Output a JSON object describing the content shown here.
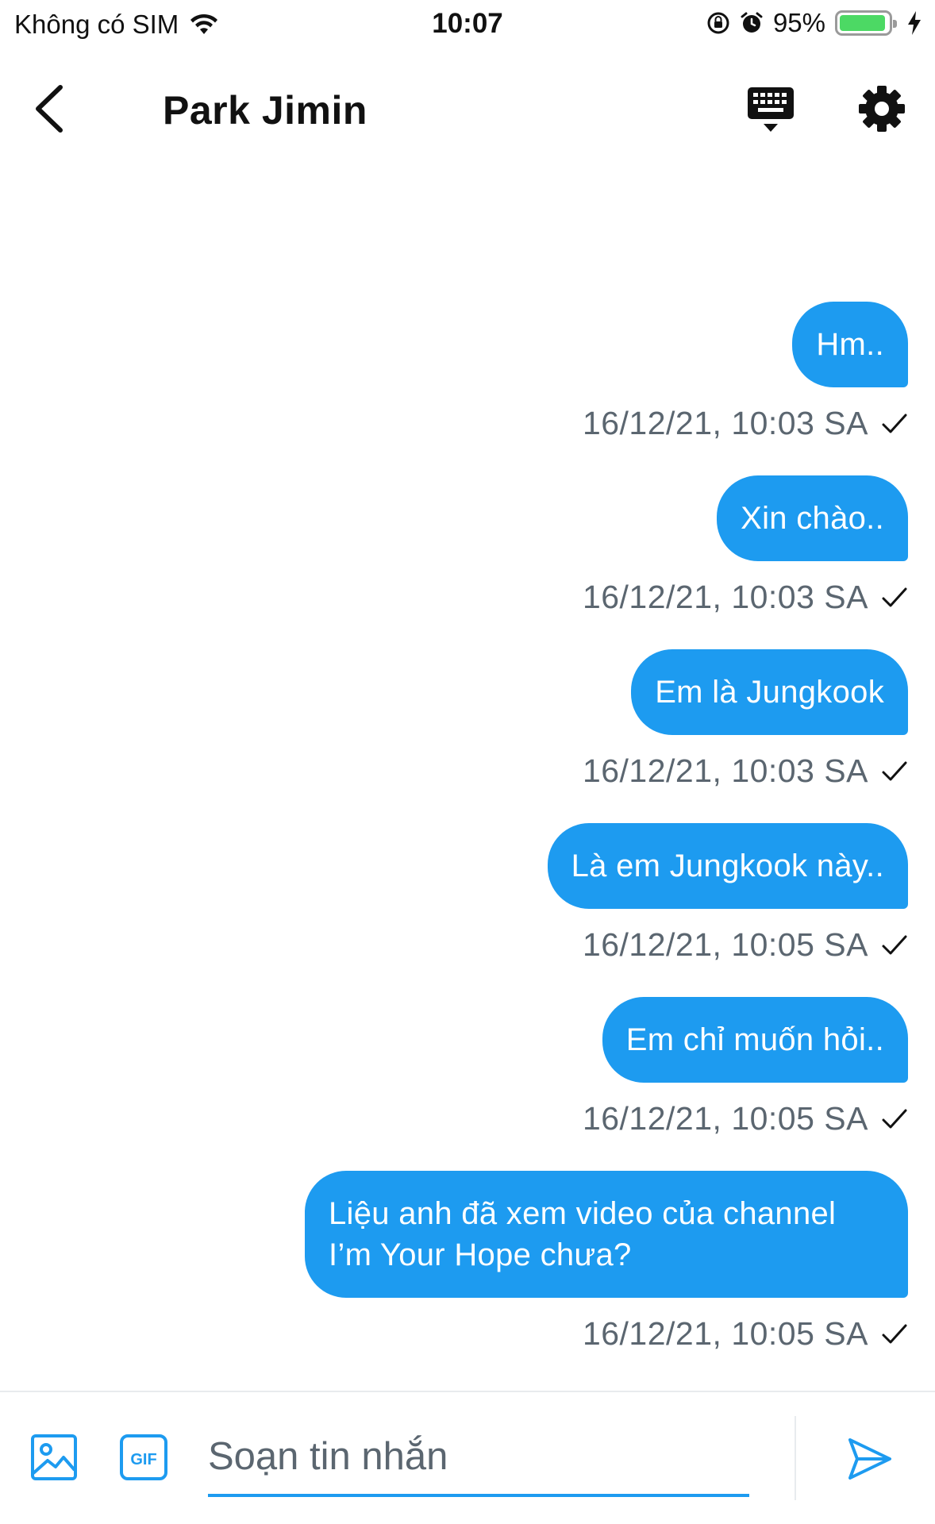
{
  "status": {
    "carrier": "Không có SIM",
    "time": "10:07",
    "battery_text": "95%",
    "battery_level": 0.95
  },
  "header": {
    "title": "Park Jimin"
  },
  "messages": [
    {
      "text": "Hm..",
      "timestamp": "16/12/21, 10:03 SA"
    },
    {
      "text": "Xin chào..",
      "timestamp": "16/12/21, 10:03 SA"
    },
    {
      "text": "Em là Jungkook",
      "timestamp": "16/12/21, 10:03 SA"
    },
    {
      "text": "Là em Jungkook này..",
      "timestamp": "16/12/21, 10:05 SA"
    },
    {
      "text": "Em chỉ muốn hỏi..",
      "timestamp": "16/12/21, 10:05 SA"
    },
    {
      "text": "Liệu anh đã xem video của channel I’m Your Hope chưa?",
      "timestamp": "16/12/21, 10:05 SA"
    }
  ],
  "composer": {
    "placeholder": "Soạn tin nhắn",
    "value": ""
  },
  "colors": {
    "accent": "#1d9bf0",
    "battery": "#4cd964",
    "meta_text": "#5b6670"
  },
  "icons": {
    "back": "chevron-left-icon",
    "keyboard": "keyboard-icon",
    "settings": "gear-icon",
    "image": "image-icon",
    "gif": "gif-icon",
    "send": "send-icon",
    "check": "check-icon"
  }
}
